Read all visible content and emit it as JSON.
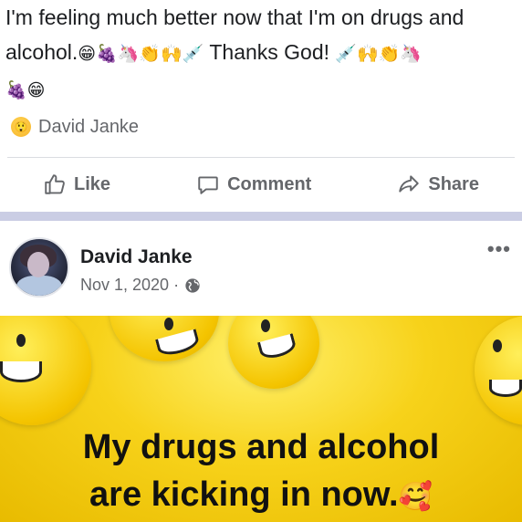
{
  "post1": {
    "text_line1": "I'm feeling much better now that I'm on drugs and",
    "text_line2_start": "alcohol.",
    "emoji_seq_a": "😁🍇🦄👏🙌💉",
    "text_line2_mid": " Thanks God! ",
    "emoji_seq_b": "💉🙌👏🦄",
    "emoji_seq_c": "🍇😁",
    "reaction_author": "David Janke",
    "actions": {
      "like": "Like",
      "comment": "Comment",
      "share": "Share"
    }
  },
  "post2": {
    "author": "David Janke",
    "date": "Nov 1, 2020 ·",
    "more": "•••",
    "image_caption_line1": "My drugs and alcohol",
    "image_caption_line2": "are kicking in now.",
    "image_caption_emoji": "🥰"
  },
  "colors": {
    "separator": "#cacde4",
    "meta_text": "#65676b",
    "image_yellow": "#f7d21a"
  },
  "icons": [
    "like-icon",
    "comment-icon",
    "share-icon",
    "globe-icon",
    "reaction-icon",
    "more-icon"
  ]
}
